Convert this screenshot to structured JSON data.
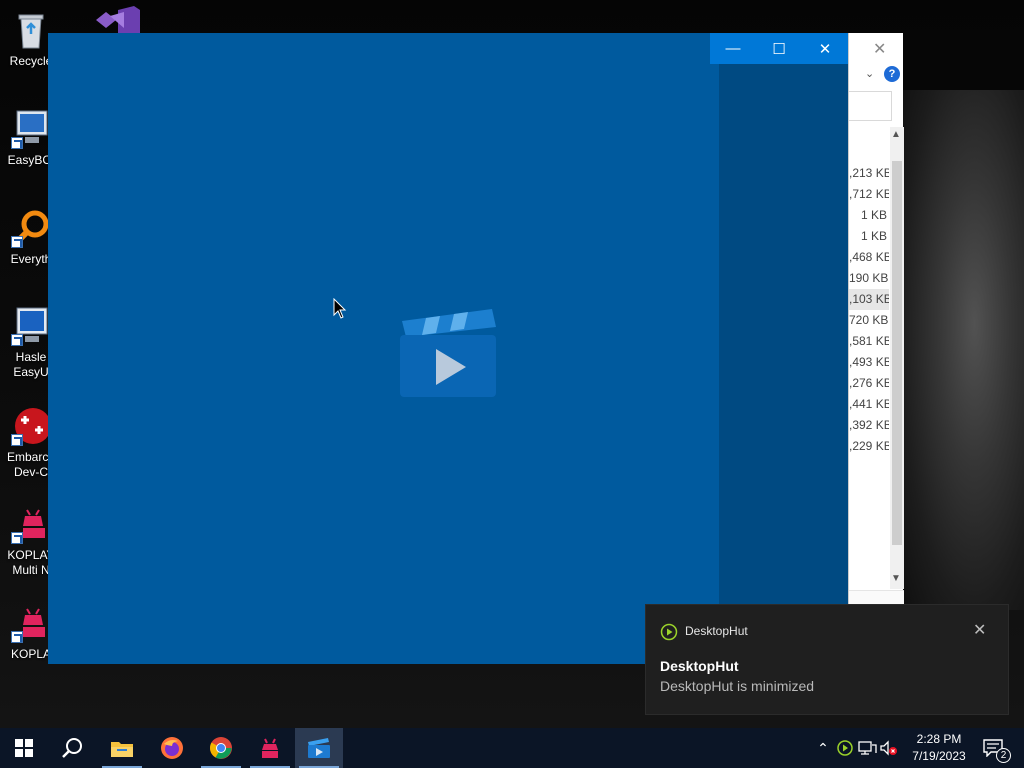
{
  "desktop": {
    "icons": [
      {
        "label_line1": "Recycle",
        "label_line2": ""
      },
      {
        "label_line1": "EasyBCI",
        "label_line2": ""
      },
      {
        "label_line1": "Everyth",
        "label_line2": ""
      },
      {
        "label_line1": "Hasle",
        "label_line2": "EasyU"
      },
      {
        "label_line1": "Embarca",
        "label_line2": "Dev-C"
      },
      {
        "label_line1": "KOPLAY",
        "label_line2": "Multi N"
      },
      {
        "label_line1": "KOPLA",
        "label_line2": ""
      }
    ]
  },
  "explorer": {
    "sizes": [
      ",213 KB",
      ",712 KB",
      "1 KB",
      "1 KB",
      ",468 KB",
      "190 KB",
      ",103 KB",
      "720 KB",
      ",581 KB",
      ",493 KB",
      ",276 KB",
      ",441 KB",
      ",392 KB",
      ",229 KB"
    ],
    "selected_index": 6,
    "help_label": "?"
  },
  "player": {
    "window_controls": {
      "minimize": "—",
      "maximize": "☐",
      "close": "✕"
    },
    "accent": "#005a9e"
  },
  "toast": {
    "app_name": "DesktopHut",
    "title": "DesktopHut",
    "body": "DesktopHut is minimized",
    "close": "✕"
  },
  "taskbar": {
    "apps": [
      {
        "name": "start-icon"
      },
      {
        "name": "search-icon"
      },
      {
        "name": "file-explorer-icon"
      },
      {
        "name": "firefox-icon"
      },
      {
        "name": "chrome-icon"
      },
      {
        "name": "koplayer-icon"
      },
      {
        "name": "desktophut-icon"
      }
    ],
    "tray": {
      "time": "2:28 PM",
      "date": "7/19/2023",
      "notification_count": "2"
    }
  }
}
